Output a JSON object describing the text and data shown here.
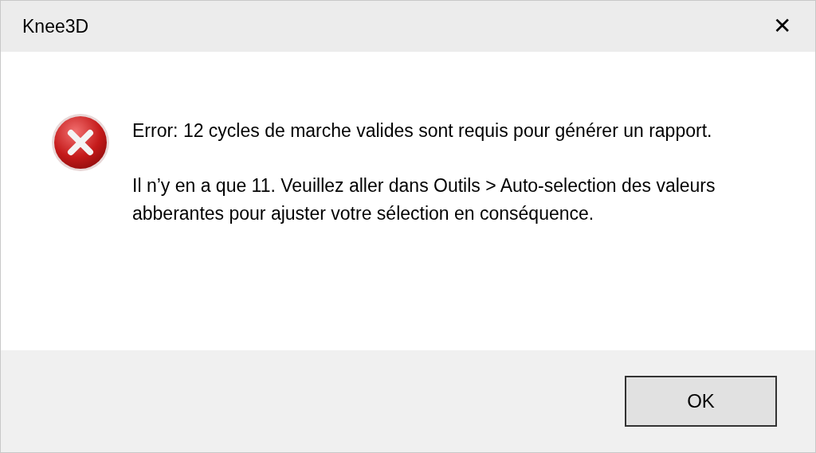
{
  "window": {
    "title": "Knee3D",
    "close": "✕"
  },
  "message": {
    "paragraphs": [
      "Error: 12 cycles de marche valides sont requis pour générer un rapport.",
      "Il n’y en a que 11. Veuillez aller dans Outils > Auto-selection des valeurs abberantes pour ajuster votre sélection en conséquence."
    ]
  },
  "buttons": [
    {
      "label": "OK"
    }
  ]
}
